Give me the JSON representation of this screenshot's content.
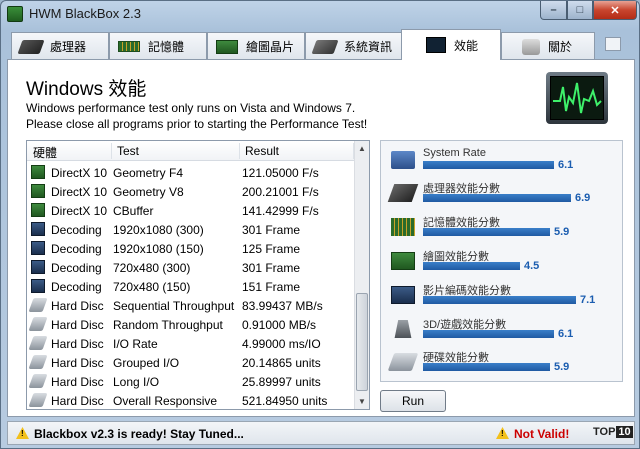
{
  "window": {
    "title": "HWM BlackBox 2.3"
  },
  "title_buttons": {
    "minimize": "–",
    "maximize": "□",
    "close": "✕"
  },
  "tabs": [
    {
      "label": "處理器",
      "icon": "cpu-icon"
    },
    {
      "label": "記憶體",
      "icon": "memory-icon"
    },
    {
      "label": "繪圖晶片",
      "icon": "gpu-icon"
    },
    {
      "label": "系統資訊",
      "icon": "system-icon"
    },
    {
      "label": "效能",
      "icon": "performance-icon",
      "active": true
    },
    {
      "label": "關於",
      "icon": "about-icon"
    }
  ],
  "main": {
    "heading": "Windows 效能",
    "desc_line1": "Windows performance test only runs on Vista and Windows 7.",
    "desc_line2": "Please close all programs prior to starting the Performance Test!"
  },
  "table": {
    "columns": [
      "硬體",
      "Test",
      "Result"
    ],
    "rows": [
      {
        "hw": "DirectX 10",
        "test": "Geometry F4",
        "result": "121.05000 F/s",
        "icon": "directx-icon"
      },
      {
        "hw": "DirectX 10",
        "test": "Geometry V8",
        "result": "200.21001 F/s",
        "icon": "directx-icon"
      },
      {
        "hw": "DirectX 10",
        "test": "CBuffer",
        "result": "141.42999 F/s",
        "icon": "directx-icon"
      },
      {
        "hw": "Decoding",
        "test": "1920x1080 (300)",
        "result": "301 Frame",
        "icon": "decoding-icon"
      },
      {
        "hw": "Decoding",
        "test": "1920x1080 (150)",
        "result": "125 Frame",
        "icon": "decoding-icon"
      },
      {
        "hw": "Decoding",
        "test": "720x480 (300)",
        "result": "301 Frame",
        "icon": "decoding-icon"
      },
      {
        "hw": "Decoding",
        "test": "720x480 (150)",
        "result": "151 Frame",
        "icon": "decoding-icon"
      },
      {
        "hw": "Hard Disc",
        "test": "Sequential Throughput",
        "result": "83.99437 MB/s",
        "icon": "hard-disc-icon"
      },
      {
        "hw": "Hard Disc",
        "test": "Random Throughput",
        "result": "0.91000 MB/s",
        "icon": "hard-disc-icon"
      },
      {
        "hw": "Hard Disc",
        "test": "I/O Rate",
        "result": "4.99000 ms/IO",
        "icon": "hard-disc-icon"
      },
      {
        "hw": "Hard Disc",
        "test": "Grouped I/O",
        "result": "20.14865 units",
        "icon": "hard-disc-icon"
      },
      {
        "hw": "Hard Disc",
        "test": "Long I/O",
        "result": "25.89997 units",
        "icon": "hard-disc-icon"
      },
      {
        "hw": "Hard Disc",
        "test": "Overall Responsive",
        "result": "521.84950 units",
        "icon": "hard-disc-icon"
      }
    ]
  },
  "ratings": [
    {
      "label": "System Rate",
      "value": "6.1",
      "score": 6.1,
      "icon": "system-rate-icon"
    },
    {
      "label": "處理器效能分數",
      "value": "6.9",
      "score": 6.9,
      "icon": "cpu-icon"
    },
    {
      "label": "記憶體效能分數",
      "value": "5.9",
      "score": 5.9,
      "icon": "memory-icon"
    },
    {
      "label": "繪圖效能分數",
      "value": "4.5",
      "score": 4.5,
      "icon": "gpu-icon"
    },
    {
      "label": "影片編碼效能分數",
      "value": "7.1",
      "score": 7.1,
      "icon": "video-icon"
    },
    {
      "label": "3D/遊戲效能分數",
      "value": "6.1",
      "score": 6.1,
      "icon": "3d-game-icon"
    },
    {
      "label": "硬碟效能分數",
      "value": "5.9",
      "score": 5.9,
      "icon": "hard-disc-icon"
    }
  ],
  "run_button": "Run",
  "status": {
    "left": "Blackbox v2.3 is ready! Stay Tuned...",
    "right": "Not Valid!",
    "logo_top": "TOP",
    "logo_num": "10"
  }
}
